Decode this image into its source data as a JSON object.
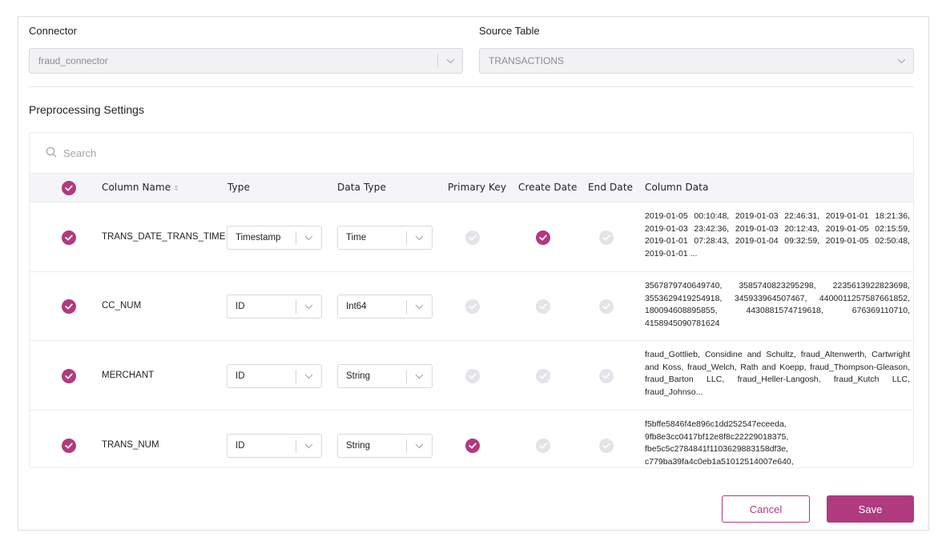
{
  "form": {
    "connector_label": "Connector",
    "connector_value": "fraud_connector",
    "source_table_label": "Source Table",
    "source_table_value": "TRANSACTIONS",
    "section_title": "Preprocessing Settings"
  },
  "search": {
    "placeholder": "Search"
  },
  "table": {
    "headers": {
      "column_name": "Column Name",
      "type": "Type",
      "data_type": "Data Type",
      "primary_key": "Primary Key",
      "create_date": "Create Date",
      "end_date": "End Date",
      "column_data": "Column Data"
    },
    "rows": [
      {
        "selected": true,
        "name": "TRANS_DATE_TRANS_TIME",
        "type": "Timestamp",
        "data_type": "Time",
        "primary_key": false,
        "create_date": true,
        "end_date": false,
        "column_data": "2019-01-05 00:10:48, 2019-01-03 22:46:31, 2019-01-01 18:21:36, 2019-01-03 23:42:36, 2019-01-03 20:12:43, 2019-01-05 02:15:59, 2019-01-01 07:28:43, 2019-01-04 09:32:59, 2019-01-05 02:50:48, 2019-01-01 ..."
      },
      {
        "selected": true,
        "name": "CC_NUM",
        "type": "ID",
        "data_type": "Int64",
        "primary_key": false,
        "create_date": false,
        "end_date": false,
        "column_data": "3567879740649740, 3585740823295298, 2235613922823698, 3553629419254918, 345933964507467, 4400011257587661852, 180094608895855, 4430881574719618, 676369110710, 4158945090781624"
      },
      {
        "selected": true,
        "name": "MERCHANT",
        "type": "ID",
        "data_type": "String",
        "primary_key": false,
        "create_date": false,
        "end_date": false,
        "column_data": "fraud_Gottlieb, Considine and Schultz, fraud_Altenwerth, Cartwright and Koss, fraud_Welch, Rath and Koepp, fraud_Thompson-Gleason, fraud_Barton LLC, fraud_Heller-Langosh, fraud_Kutch LLC, fraud_Johnso..."
      },
      {
        "selected": true,
        "name": "TRANS_NUM",
        "type": "ID",
        "data_type": "String",
        "primary_key": true,
        "create_date": false,
        "end_date": false,
        "column_data": "f5bffe5846f4e896c1dd252547eceeda, 9fb8e3cc0417bf12e8f8c22229018375, fbe5c5c2784841f1103629883158df3e, c779ba39fa4c0eb1a51012514007e640,"
      }
    ]
  },
  "buttons": {
    "cancel": "Cancel",
    "save": "Save"
  },
  "colors": {
    "accent": "#b03a7e",
    "check_off": "#e3e4ea"
  },
  "icons": {
    "search": "search-icon",
    "chevron": "chevron-down-icon",
    "check": "check-icon",
    "sort": "sort-icon"
  }
}
